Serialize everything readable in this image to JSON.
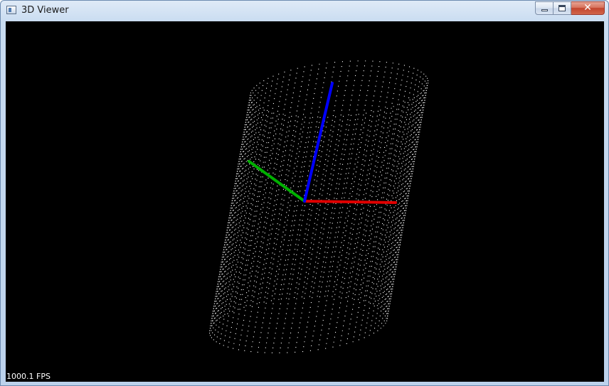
{
  "window": {
    "title": "3D Viewer",
    "controls": {
      "minimize": "minimize",
      "maximize": "maximize",
      "close": "✕"
    }
  },
  "viewer": {
    "background_color": "#000000",
    "point_color": "#ffffff",
    "axes": [
      {
        "name": "x",
        "color": "#e00000"
      },
      {
        "name": "y",
        "color": "#00b000"
      },
      {
        "name": "z",
        "color": "#0000ff"
      }
    ],
    "point_cloud_shape": "cylinder",
    "fps_label": "1000.1 FPS"
  }
}
